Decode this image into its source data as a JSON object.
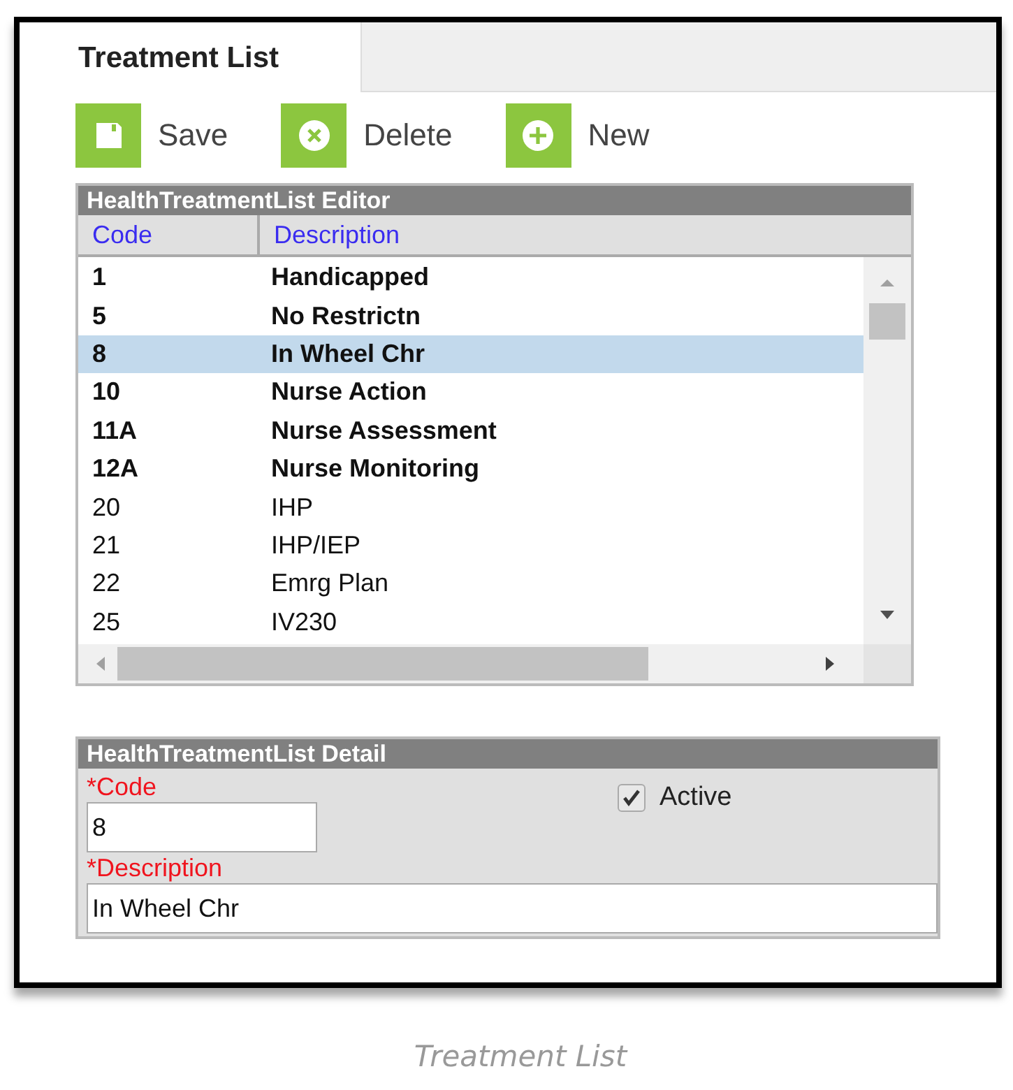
{
  "tabs": [
    {
      "label": "Treatment List",
      "selected": true
    }
  ],
  "toolbar": [
    {
      "kind": "save",
      "label": "Save"
    },
    {
      "kind": "delete",
      "label": "Delete"
    },
    {
      "kind": "new",
      "label": "New"
    }
  ],
  "editor": {
    "title": "HealthTreatmentList Editor",
    "columns": [
      "Code",
      "Description"
    ],
    "rows": [
      {
        "code": "1",
        "description": "Handicapped",
        "bold": true,
        "selected": false
      },
      {
        "code": "5",
        "description": "No Restrictn",
        "bold": true,
        "selected": false
      },
      {
        "code": "8",
        "description": "In Wheel Chr",
        "bold": true,
        "selected": true
      },
      {
        "code": "10",
        "description": "Nurse Action",
        "bold": true,
        "selected": false
      },
      {
        "code": "11A",
        "description": "Nurse Assessment",
        "bold": true,
        "selected": false
      },
      {
        "code": "12A",
        "description": "Nurse Monitoring",
        "bold": true,
        "selected": false
      },
      {
        "code": "20",
        "description": "IHP",
        "bold": false,
        "selected": false
      },
      {
        "code": "21",
        "description": "IHP/IEP",
        "bold": false,
        "selected": false
      },
      {
        "code": "22",
        "description": "Emrg Plan",
        "bold": false,
        "selected": false
      },
      {
        "code": "25",
        "description": "IV230",
        "bold": false,
        "selected": false
      }
    ]
  },
  "detail": {
    "title": "HealthTreatmentList Detail",
    "code_label": "*Code",
    "code_value": "8",
    "active_label": "Active",
    "active_checked": true,
    "description_label": "*Description",
    "description_value": "In Wheel Chr"
  },
  "caption": "Treatment List"
}
